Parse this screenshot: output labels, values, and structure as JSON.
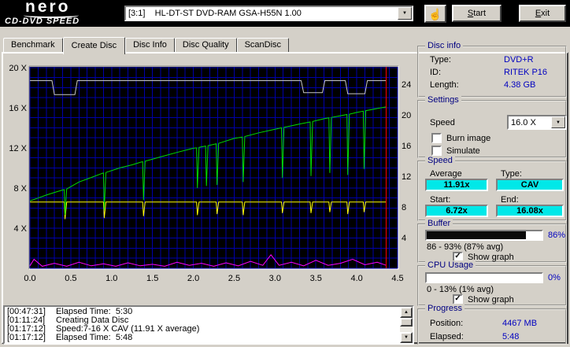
{
  "colors": {
    "window_bg": "#d4d0c8",
    "topbar_bg": "#000000",
    "group_title_navy": "#000080",
    "value_blue": "#0000c0",
    "accent_cyan": "#00e8e8",
    "bar_fill": "#0a0a0a"
  },
  "header": {
    "logo_top": "nero",
    "logo_bottom": "CD-DVD SPEED",
    "drive": "[3:1]    HL-DT-ST DVD-RAM GSA-H55N 1.00",
    "start_button": "Start",
    "exit_button": "Exit"
  },
  "tabs": [
    {
      "label": "Benchmark",
      "active": false
    },
    {
      "label": "Create Disc",
      "active": true
    },
    {
      "label": "Disc Info",
      "active": false
    },
    {
      "label": "Disc Quality",
      "active": false
    },
    {
      "label": "ScanDisc",
      "active": false
    }
  ],
  "chart_data": {
    "type": "line",
    "title": "",
    "background": "#000000",
    "grid_color": "#0000aa",
    "x_axis": {
      "min": 0,
      "max": 4.5,
      "grid_step": 0.1,
      "unit": "GB",
      "tick_values": [
        0,
        0.5,
        1,
        1.5,
        2,
        2.5,
        3,
        3.5,
        4,
        4.5
      ],
      "tick_labels": [
        "0.0",
        "0.5",
        "1.0",
        "1.5",
        "2.0",
        "2.5",
        "3.0",
        "3.5",
        "4.0",
        "4.5"
      ]
    },
    "y_axis_left": {
      "min": 0,
      "max": 20.07,
      "grid_step": 1,
      "tick_values": [
        20,
        16,
        12,
        8,
        4
      ],
      "tick_labels": [
        "20 X",
        "16 X",
        "12 X",
        "8 X",
        "4 X"
      ]
    },
    "y_axis_right": {
      "min": 0,
      "max": 24,
      "tick_values": [
        24,
        20,
        16,
        12,
        8,
        4
      ],
      "tick_labels": [
        "24",
        "20",
        "16",
        "12",
        "8",
        "4"
      ]
    },
    "series": [
      {
        "name": "buffer-level",
        "color": "#c8c8c8",
        "points": [
          [
            0,
            18.7
          ],
          [
            0.27,
            18.7
          ],
          [
            0.3,
            17.3
          ],
          [
            0.55,
            17.3
          ],
          [
            0.58,
            18.7
          ],
          [
            3.32,
            18.7
          ],
          [
            3.35,
            17.5
          ],
          [
            3.58,
            17.5
          ],
          [
            3.61,
            18.7
          ],
          [
            3.86,
            18.7
          ],
          [
            3.89,
            17.4
          ],
          [
            4.1,
            17.4
          ],
          [
            4.13,
            18.7
          ],
          [
            4.36,
            18.7
          ]
        ]
      },
      {
        "name": "yellow-reference-speed",
        "color": "#ffff00",
        "points": [
          [
            0,
            6.6
          ],
          [
            0.42,
            6.6
          ],
          [
            0.43,
            4.9
          ],
          [
            0.45,
            6.6
          ],
          [
            0.9,
            6.6
          ],
          [
            0.91,
            5.0
          ],
          [
            0.93,
            6.6
          ],
          [
            1.38,
            6.6
          ],
          [
            1.39,
            5.2
          ],
          [
            1.41,
            6.6
          ],
          [
            2.04,
            6.6
          ],
          [
            2.05,
            5.3
          ],
          [
            2.07,
            6.6
          ],
          [
            2.28,
            6.6
          ],
          [
            2.29,
            5.4
          ],
          [
            2.31,
            6.6
          ],
          [
            2.6,
            6.6
          ],
          [
            2.61,
            5.3
          ],
          [
            2.63,
            6.6
          ],
          [
            3.08,
            6.6
          ],
          [
            3.09,
            5.5
          ],
          [
            3.11,
            6.6
          ],
          [
            3.43,
            6.6
          ],
          [
            3.44,
            5.5
          ],
          [
            3.46,
            6.6
          ],
          [
            3.66,
            6.6
          ],
          [
            3.67,
            5.6
          ],
          [
            3.69,
            6.6
          ],
          [
            3.88,
            6.6
          ],
          [
            3.89,
            5.4
          ],
          [
            3.91,
            6.6
          ],
          [
            4.08,
            6.6
          ],
          [
            4.09,
            5.6
          ],
          [
            4.11,
            6.6
          ],
          [
            4.36,
            6.6
          ]
        ]
      },
      {
        "name": "write-speed",
        "color": "#00dc00",
        "points": [
          [
            0,
            6.72
          ],
          [
            0.1,
            7.0
          ],
          [
            0.2,
            7.3
          ],
          [
            0.3,
            7.56
          ],
          [
            0.4,
            7.8
          ],
          [
            0.42,
            7.84
          ],
          [
            0.43,
            5.3
          ],
          [
            0.45,
            7.9
          ],
          [
            0.6,
            8.6
          ],
          [
            0.75,
            9.05
          ],
          [
            0.88,
            9.45
          ],
          [
            0.9,
            9.5
          ],
          [
            0.91,
            5.8
          ],
          [
            0.93,
            9.55
          ],
          [
            1.1,
            10.0
          ],
          [
            1.25,
            10.31
          ],
          [
            1.36,
            10.58
          ],
          [
            1.38,
            10.62
          ],
          [
            1.39,
            6.8
          ],
          [
            1.41,
            10.67
          ],
          [
            1.6,
            11.1
          ],
          [
            1.8,
            11.55
          ],
          [
            2.0,
            11.96
          ],
          [
            2.04,
            12.0
          ],
          [
            2.05,
            8.0
          ],
          [
            2.07,
            12.05
          ],
          [
            2.15,
            12.18
          ],
          [
            2.16,
            8.2
          ],
          [
            2.18,
            12.22
          ],
          [
            2.28,
            12.4
          ],
          [
            2.29,
            8.3
          ],
          [
            2.31,
            12.45
          ],
          [
            2.5,
            12.94
          ],
          [
            2.6,
            13.08
          ],
          [
            2.61,
            8.6
          ],
          [
            2.63,
            13.13
          ],
          [
            2.8,
            13.5
          ],
          [
            3.0,
            13.86
          ],
          [
            3.08,
            14.0
          ],
          [
            3.09,
            9.0
          ],
          [
            3.11,
            14.04
          ],
          [
            3.3,
            14.38
          ],
          [
            3.43,
            14.58
          ],
          [
            3.44,
            9.2
          ],
          [
            3.46,
            14.63
          ],
          [
            3.6,
            14.9
          ],
          [
            3.66,
            15.0
          ],
          [
            3.67,
            9.5
          ],
          [
            3.69,
            15.03
          ],
          [
            3.8,
            15.2
          ],
          [
            3.88,
            15.33
          ],
          [
            3.89,
            9.3
          ],
          [
            3.91,
            15.36
          ],
          [
            4.0,
            15.53
          ],
          [
            4.08,
            15.66
          ],
          [
            4.09,
            9.9
          ],
          [
            4.11,
            15.7
          ],
          [
            4.25,
            15.92
          ],
          [
            4.36,
            16.08
          ]
        ]
      },
      {
        "name": "cpu-usage",
        "color": "#ff00ff",
        "points": [
          [
            0,
            0.25
          ],
          [
            0.05,
            0.9
          ],
          [
            0.15,
            0.2
          ],
          [
            0.3,
            0.5
          ],
          [
            0.45,
            0.2
          ],
          [
            0.6,
            0.6
          ],
          [
            0.75,
            0.25
          ],
          [
            0.9,
            0.45
          ],
          [
            1.05,
            0.2
          ],
          [
            1.2,
            0.55
          ],
          [
            1.35,
            0.25
          ],
          [
            1.5,
            0.4
          ],
          [
            1.65,
            0.2
          ],
          [
            1.8,
            0.6
          ],
          [
            1.95,
            0.3
          ],
          [
            2.1,
            0.5
          ],
          [
            2.25,
            0.2
          ],
          [
            2.4,
            0.55
          ],
          [
            2.55,
            0.25
          ],
          [
            2.7,
            0.7
          ],
          [
            2.85,
            0.3
          ],
          [
            2.95,
            1.35
          ],
          [
            3.05,
            0.3
          ],
          [
            3.2,
            0.6
          ],
          [
            3.35,
            0.25
          ],
          [
            3.5,
            0.8
          ],
          [
            3.65,
            0.3
          ],
          [
            3.8,
            0.5
          ],
          [
            3.95,
            0.9
          ],
          [
            4.1,
            0.35
          ],
          [
            4.25,
            0.6
          ],
          [
            4.36,
            0.3
          ]
        ]
      }
    ],
    "cursor": {
      "x": 4.36,
      "color": "#ff0000"
    }
  },
  "panels": {
    "disc_info": {
      "title": "Disc info",
      "rows": [
        {
          "label": "Type:",
          "value": "DVD+R"
        },
        {
          "label": "ID:",
          "value": "RITEK P16"
        },
        {
          "label": "Length:",
          "value": "4.38 GB"
        }
      ]
    },
    "settings": {
      "title": "Settings",
      "speed_label": "Speed",
      "speed_value": "16.0 X",
      "checkboxes": [
        {
          "label": "Burn image",
          "checked": false
        },
        {
          "label": "Simulate",
          "checked": false
        }
      ]
    },
    "speed": {
      "title": "Speed",
      "average_label": "Average",
      "average_value": "11.91x",
      "type_label": "Type:",
      "type_value": "CAV",
      "start_label": "Start:",
      "start_value": "6.72x",
      "end_label": "End:",
      "end_value": "16.08x"
    },
    "buffer": {
      "title": "Buffer",
      "percent": "86%",
      "fill_percent": 86,
      "range": "86 - 93% (87% avg)",
      "show_graph": "Show graph",
      "graph_checked": true
    },
    "cpu": {
      "title": "CPU Usage",
      "percent": "0%",
      "fill_percent": 0,
      "range": "0 - 13% (1% avg)",
      "show_graph": "Show graph",
      "graph_checked": true
    },
    "progress": {
      "title": "Progress",
      "position_label": "Position:",
      "position_value": "4467 MB",
      "elapsed_label": "Elapsed:",
      "elapsed_value": "5:48"
    }
  },
  "log": {
    "entries": [
      {
        "time": "[00:47:31]",
        "text": "Elapsed Time:  5:30"
      },
      {
        "time": "[01:11:24]",
        "text": "Creating Data Disc"
      },
      {
        "time": "[01:17:12]",
        "text": "Speed:7-16 X CAV (11.91 X average)"
      },
      {
        "time": "[01:17:12]",
        "text": "Elapsed Time:  5:48"
      }
    ]
  }
}
